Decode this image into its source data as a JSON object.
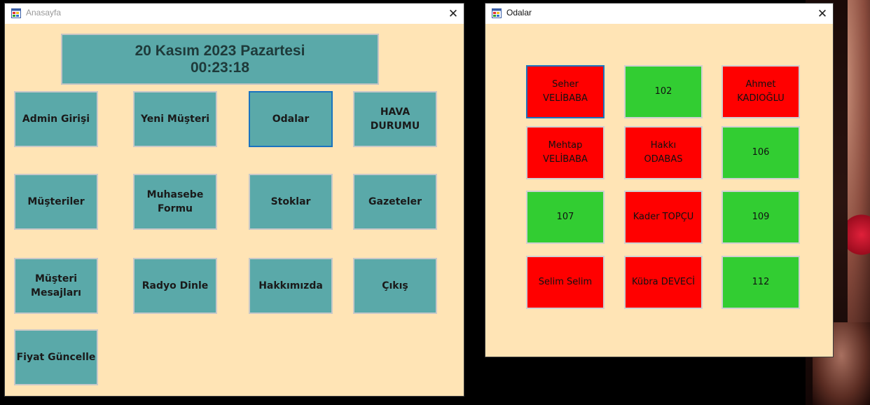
{
  "main_window": {
    "title": "Anasayfa",
    "clock": {
      "date": "20 Kasım 2023 Pazartesi",
      "time": "00:23:18"
    },
    "buttons": [
      {
        "label": "Admin Girişi"
      },
      {
        "label": "Yeni Müşteri"
      },
      {
        "label": "Odalar"
      },
      {
        "label": "HAVA\nDURUMU"
      },
      {
        "label": "Müşteriler"
      },
      {
        "label": "Muhasebe\nFormu"
      },
      {
        "label": "Stoklar"
      },
      {
        "label": "Gazeteler"
      },
      {
        "label": "Müşteri\nMesajları"
      },
      {
        "label": "Radyo Dinle"
      },
      {
        "label": "Hakkımızda"
      },
      {
        "label": "Çıkış"
      },
      {
        "label": "Fiyat Güncelle"
      }
    ]
  },
  "rooms_window": {
    "title": "Odalar",
    "rooms": [
      {
        "label": "Seher\nVELİBABA",
        "status": "occupied"
      },
      {
        "label": "102",
        "status": "free"
      },
      {
        "label": "Ahmet\nKADIOĞLU",
        "status": "occupied"
      },
      {
        "label": "Mehtap\nVELİBABA",
        "status": "occupied"
      },
      {
        "label": "Hakkı\nODABAS",
        "status": "occupied"
      },
      {
        "label": "106",
        "status": "free"
      },
      {
        "label": "107",
        "status": "free"
      },
      {
        "label": "Kader TOPÇU",
        "status": "occupied"
      },
      {
        "label": "109",
        "status": "free"
      },
      {
        "label": "Selim Selim",
        "status": "occupied"
      },
      {
        "label": "Kübra DEVECİ",
        "status": "occupied"
      },
      {
        "label": "112",
        "status": "free"
      }
    ]
  },
  "colors": {
    "window_bg": "#ffe4b5",
    "button_bg": "#5aa9a9",
    "occupied": "#ff0000",
    "free": "#32cd32",
    "focus_border": "#1a73c0"
  }
}
